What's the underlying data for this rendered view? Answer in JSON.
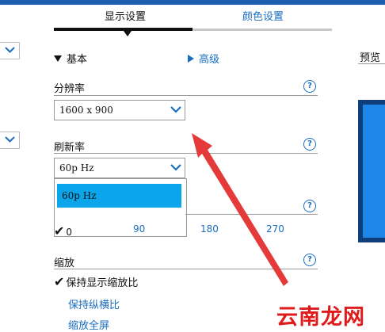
{
  "tabs": {
    "display_settings": "显示设置",
    "color_settings": "颜色设置"
  },
  "mode": {
    "basic": "基本",
    "advanced": "高级"
  },
  "resolution": {
    "label": "分辨率",
    "value": "1600  x  900",
    "help": "?"
  },
  "refresh": {
    "label": "刷新率",
    "value": "60p Hz",
    "help": "?",
    "dropdown_option": "60p Hz"
  },
  "rotation": {
    "help": "?",
    "options": [
      "0",
      "90",
      "180",
      "270"
    ],
    "selected": "0"
  },
  "scaling": {
    "label": "缩放",
    "help": "?",
    "options": [
      "保持显示缩放比",
      "保持纵横比",
      "缩放全屏"
    ],
    "selected": "保持显示缩放比"
  },
  "preview": {
    "label": "预览"
  },
  "watermark": "云南龙网",
  "colors": {
    "accent": "#1a6ec2",
    "highlight": "#0aa5ea",
    "arrow": "#e53a3a",
    "topbar": "#1d5fae"
  }
}
